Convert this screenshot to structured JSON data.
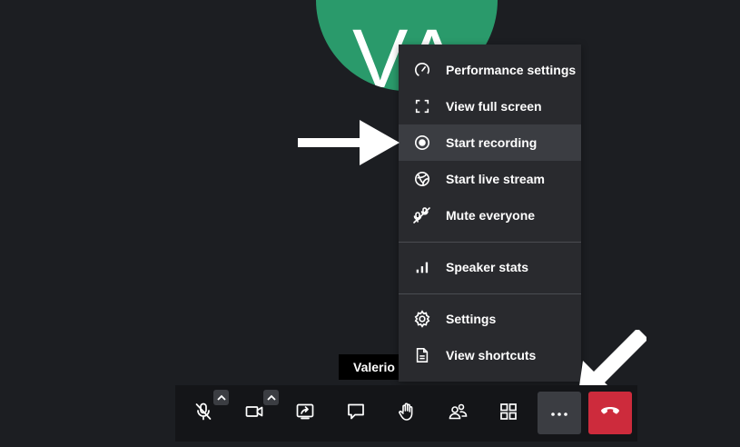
{
  "participant": {
    "initials": "VA",
    "name_tag": "Valerio"
  },
  "menu": {
    "items": [
      {
        "label": "Performance settings",
        "icon": "gauge-icon"
      },
      {
        "label": "View full screen",
        "icon": "fullscreen-icon"
      },
      {
        "label": "Start recording",
        "icon": "record-icon"
      },
      {
        "label": "Start live stream",
        "icon": "live-stream-icon"
      },
      {
        "label": "Mute everyone",
        "icon": "mute-everyone-icon"
      },
      {
        "label": "Speaker stats",
        "icon": "bar-chart-icon"
      },
      {
        "label": "Settings",
        "icon": "gear-icon"
      },
      {
        "label": "View shortcuts",
        "icon": "document-icon"
      }
    ]
  },
  "toolbar": {
    "buttons": [
      "microphone-muted-icon",
      "camera-icon",
      "share-screen-icon",
      "chat-icon",
      "raise-hand-icon",
      "participants-icon",
      "tile-view-icon",
      "more-icon",
      "hangup-icon"
    ]
  },
  "colors": {
    "background": "#1c1e22",
    "avatar": "#2a9a6b",
    "menu": "#292a2e",
    "hover": "#3b3d42",
    "hangup": "#cd2b3c"
  }
}
